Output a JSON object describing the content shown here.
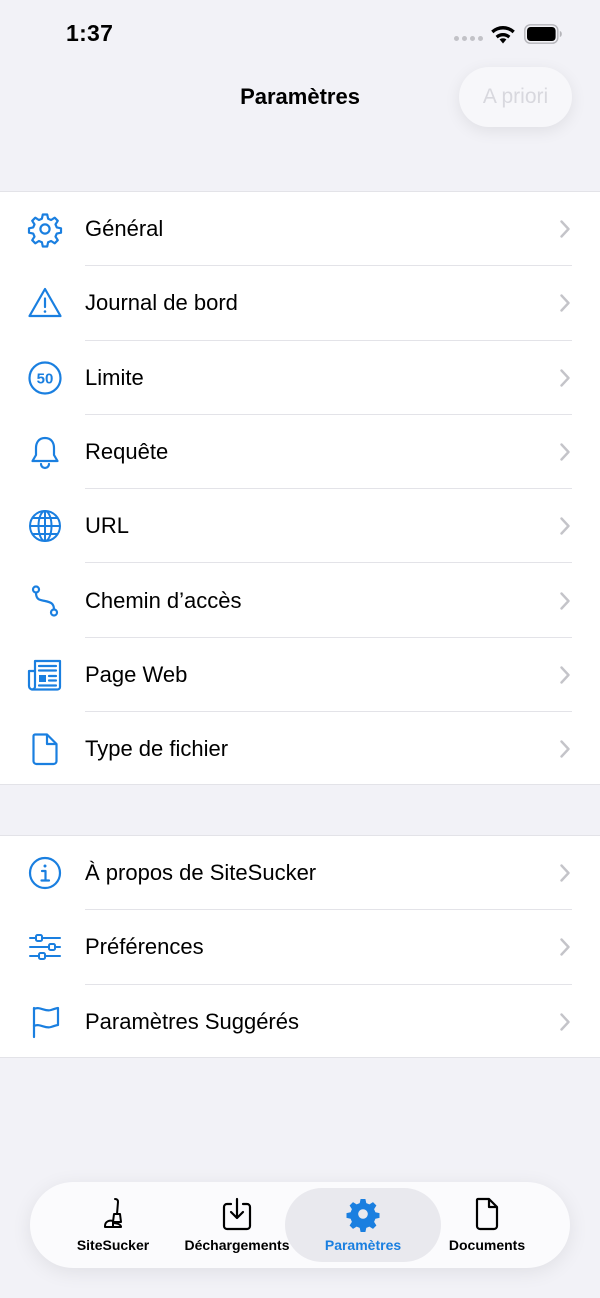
{
  "status_bar": {
    "time": "1:37"
  },
  "nav": {
    "title": "Paramètres",
    "action_label": "A priori"
  },
  "colors": {
    "accent": "#1a7fe0",
    "chevron": "#c4c4c9",
    "background": "#f2f2f7"
  },
  "settings_group": [
    {
      "icon": "gear-icon",
      "label": "Général"
    },
    {
      "icon": "warning-triangle-icon",
      "label": "Journal de bord"
    },
    {
      "icon": "speed-limit-50-icon",
      "label": "Limite"
    },
    {
      "icon": "bell-icon",
      "label": "Requête"
    },
    {
      "icon": "globe-icon",
      "label": "URL"
    },
    {
      "icon": "path-icon",
      "label": "Chemin d’accès"
    },
    {
      "icon": "newspaper-icon",
      "label": "Page Web"
    },
    {
      "icon": "document-icon",
      "label": "Type de fichier"
    }
  ],
  "limit_icon_text": "50",
  "app_group": [
    {
      "icon": "info-icon",
      "label": "À propos de SiteSucker"
    },
    {
      "icon": "sliders-icon",
      "label": "Préférences"
    },
    {
      "icon": "flag-icon",
      "label": "Paramètres Suggérés"
    }
  ],
  "tabs": [
    {
      "icon": "vacuum-icon",
      "label": "SiteSucker",
      "selected": false
    },
    {
      "icon": "download-tray-icon",
      "label": "Déchargements",
      "selected": false
    },
    {
      "icon": "gear-icon",
      "label": "Paramètres",
      "selected": true
    },
    {
      "icon": "document-icon",
      "label": "Documents",
      "selected": false
    }
  ]
}
